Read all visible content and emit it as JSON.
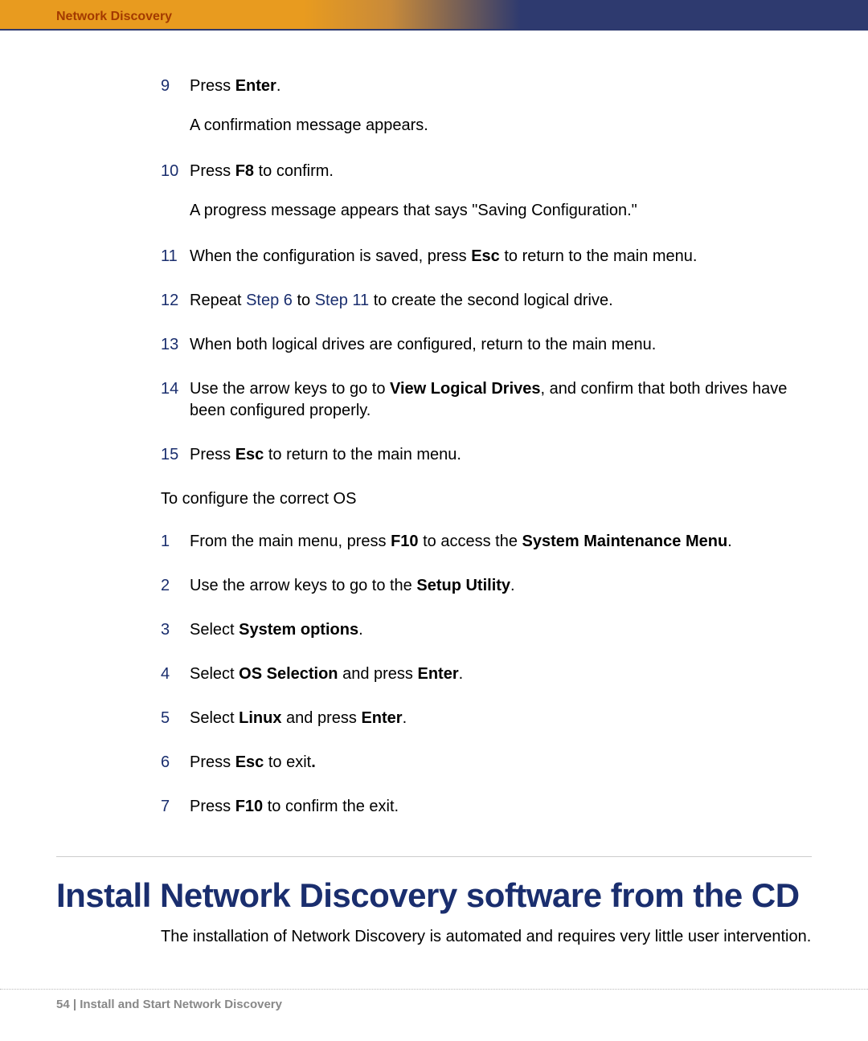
{
  "header": {
    "title": "Network Discovery"
  },
  "stepsA": [
    {
      "num": "9",
      "body_html": "Press <b>Enter</b>.",
      "sub": "A confirmation message appears."
    },
    {
      "num": "10",
      "body_html": "Press <b>F8</b> to confirm.",
      "sub": "A progress message appears that says \"Saving Configuration.\""
    },
    {
      "num": "11",
      "body_html": "When the configuration is saved, press <b>Esc</b> to return to the main menu."
    },
    {
      "num": "12",
      "body_html": "Repeat <span class=\"link\">Step 6</span> to <span class=\"link\">Step 11</span> to create the second logical drive."
    },
    {
      "num": "13",
      "body_html": "When both logical drives are configured, return to the main menu."
    },
    {
      "num": "14",
      "body_html": "Use the arrow keys to go to <b>View Logical Drives</b>, and confirm that both drives have been configured properly."
    },
    {
      "num": "15",
      "body_html": "Press <b>Esc</b> to return to the main menu."
    }
  ],
  "subheading": "To configure the correct OS",
  "stepsB": [
    {
      "num": "1",
      "body_html": "From the main menu, press <b>F10</b> to access the <b>System Maintenance Menu</b>."
    },
    {
      "num": "2",
      "body_html": "Use the arrow keys to go to the <b>Setup Utility</b>."
    },
    {
      "num": "3",
      "body_html": "Select <b>System options</b>."
    },
    {
      "num": "4",
      "body_html": "Select <b>OS Selection</b> and press <b>Enter</b>."
    },
    {
      "num": "5",
      "body_html": "Select <b>Linux</b> and press <b>Enter</b>."
    },
    {
      "num": "6",
      "body_html": "Press <b>Esc</b> to exit<b>.</b>"
    },
    {
      "num": "7",
      "body_html": "Press <b>F10</b> to confirm the exit."
    }
  ],
  "section": {
    "heading": "Install Network Discovery software from the CD",
    "body": "The installation of Network Discovery is automated and requires very little user intervention."
  },
  "footer": {
    "text": "54 | Install and Start Network Discovery"
  }
}
